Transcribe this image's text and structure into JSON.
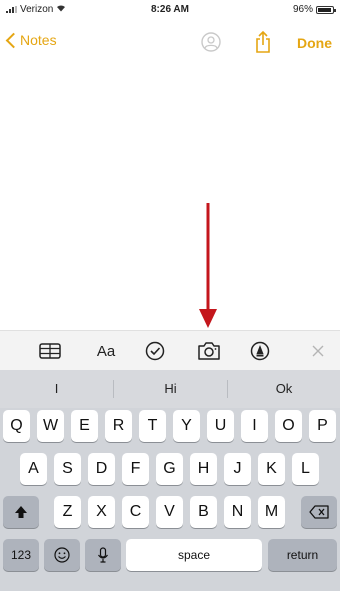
{
  "status_bar": {
    "carrier": "Verizon",
    "time": "8:26 AM",
    "battery": "96%",
    "battery_level": 0.96
  },
  "nav": {
    "back_label": "Notes",
    "done_label": "Done"
  },
  "annotation": {
    "arrow_color": "#c4161c"
  },
  "toolbar": {
    "format_label": "Aa"
  },
  "keyboard": {
    "predictions": [
      "I",
      "Hi",
      "Ok"
    ],
    "row1": [
      "Q",
      "W",
      "E",
      "R",
      "T",
      "Y",
      "U",
      "I",
      "O",
      "P"
    ],
    "row2": [
      "A",
      "S",
      "D",
      "F",
      "G",
      "H",
      "J",
      "K",
      "L"
    ],
    "row3": [
      "Z",
      "X",
      "C",
      "V",
      "B",
      "N",
      "M"
    ],
    "numbers_label": "123",
    "space_label": "space",
    "return_label": "return"
  },
  "colors": {
    "accent": "#e5a613",
    "keyboard_bg": "#d1d4d9",
    "key_bg": "#ffffff",
    "special_key_bg": "#aeb3bc"
  }
}
